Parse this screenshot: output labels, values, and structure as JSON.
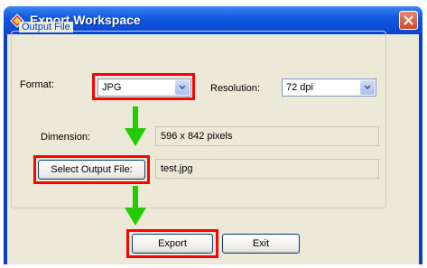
{
  "window": {
    "title": "Export Workspace"
  },
  "group": {
    "label": "Output File"
  },
  "format": {
    "label": "Format:",
    "value": "JPG"
  },
  "resolution": {
    "label": "Resolution:",
    "value": "72 dpi"
  },
  "dimension": {
    "label": "Dimension:",
    "value": "596 x 842 pixels"
  },
  "output": {
    "button_label": "Select Output File:",
    "value": "test.jpg"
  },
  "buttons": {
    "export": "Export",
    "exit": "Exit"
  },
  "colors": {
    "highlight": "#ff0000",
    "arrow": "#22cc00",
    "group_label": "#0046d5"
  }
}
